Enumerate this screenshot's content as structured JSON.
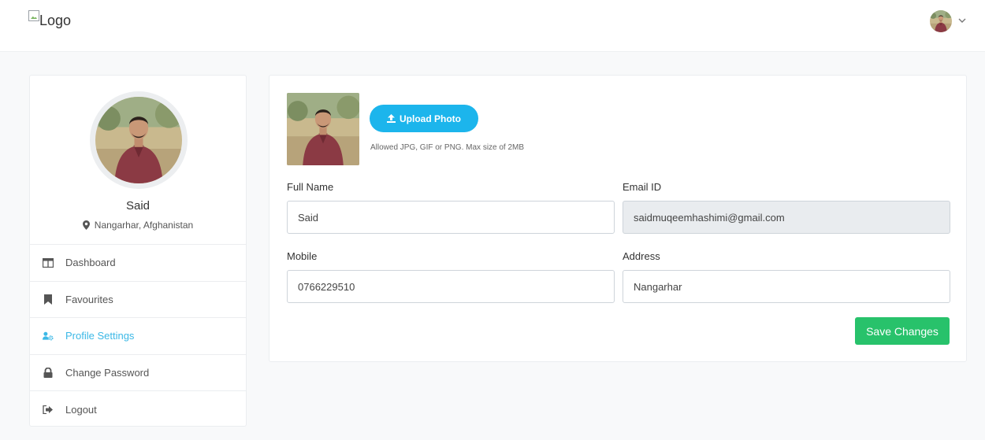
{
  "header": {
    "logo_alt": "Logo"
  },
  "sidebar": {
    "name": "Said",
    "location": "Nangarhar, Afghanistan",
    "items": [
      {
        "label": "Dashboard",
        "icon": "dashboard-icon",
        "active": false
      },
      {
        "label": "Favourites",
        "icon": "bookmark-icon",
        "active": false
      },
      {
        "label": "Profile Settings",
        "icon": "user-cog-icon",
        "active": true
      },
      {
        "label": "Change Password",
        "icon": "lock-icon",
        "active": false
      },
      {
        "label": "Logout",
        "icon": "sign-out-icon",
        "active": false
      }
    ]
  },
  "main": {
    "upload_label": "Upload Photo",
    "upload_hint": "Allowed JPG, GIF or PNG. Max size of 2MB",
    "fields": {
      "full_name": {
        "label": "Full Name",
        "value": "Said"
      },
      "email": {
        "label": "Email ID",
        "value": "saidmuqeemhashimi@gmail.com"
      },
      "mobile": {
        "label": "Mobile",
        "value": "0766229510"
      },
      "address": {
        "label": "Address",
        "value": "Nangarhar"
      }
    },
    "save_label": "Save Changes"
  },
  "colors": {
    "accent": "#1cb5ec",
    "active_nav": "#3bb8e6",
    "save": "#28c26b"
  }
}
